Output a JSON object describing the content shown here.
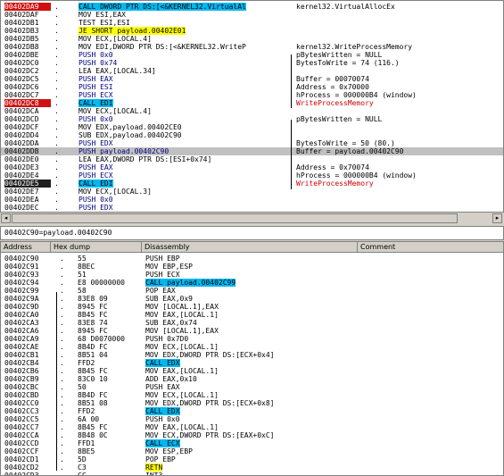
{
  "colors": {
    "breakpoint": "#d01010",
    "call": "#00b8f0",
    "jump": "#ffff00",
    "comment_red": "#d00000",
    "selected": "#c0c0c0"
  },
  "cpu": {
    "rows": [
      {
        "addr": "00402DA9",
        "instr": "CALL DWORD PTR DS:[<&KERNEL32.VirtualAl",
        "comment": "kernel32.VirtualAllocEx",
        "style": "bp",
        "ihl": "call"
      },
      {
        "addr": "00402DAF",
        "instr": "MOV ESI,EAX",
        "comment": ""
      },
      {
        "addr": "00402DB1",
        "instr": "TEST ESI,ESI",
        "comment": ""
      },
      {
        "addr": "00402DB3",
        "instr": "JE SHORT payload.00402E01",
        "comment": "",
        "ihl": "jmp"
      },
      {
        "addr": "00402DB5",
        "instr": "MOV ECX,[LOCAL.4]",
        "comment": ""
      },
      {
        "addr": "00402DB8",
        "instr": "MOV EDI,DWORD PTR DS:[<&KERNEL32.WriteP",
        "comment": "kernel32.WriteProcessMemory"
      },
      {
        "addr": "00402DBE",
        "instr": "PUSH 0x0",
        "comment": "pBytesWritten = NULL",
        "push": true
      },
      {
        "addr": "00402DC0",
        "instr": "PUSH 0x74",
        "comment": "BytesToWrite = 74 (116.)",
        "push": true
      },
      {
        "addr": "00402DC2",
        "instr": "LEA EAX,[LOCAL.34]",
        "comment": ""
      },
      {
        "addr": "00402DC5",
        "instr": "PUSH EAX",
        "comment": "Buffer = 00070074",
        "push": true
      },
      {
        "addr": "00402DC6",
        "instr": "PUSH ESI",
        "comment": "Address = 0x70000",
        "push": true
      },
      {
        "addr": "00402DC7",
        "instr": "PUSH ECX",
        "comment": "hProcess = 000000B4 (window)",
        "push": true
      },
      {
        "addr": "00402DC8",
        "instr": "CALL EDI",
        "comment": "WriteProcessMemory",
        "style": "bp",
        "ihl": "call",
        "cred": true
      },
      {
        "addr": "00402DCA",
        "instr": "MOV ECX,[LOCAL.4]",
        "comment": ""
      },
      {
        "addr": "00402DCD",
        "instr": "PUSH 0x0",
        "comment": "pBytesWritten = NULL",
        "push": true
      },
      {
        "addr": "00402DCF",
        "instr": "MOV EDX,payload.00402CE0",
        "comment": ""
      },
      {
        "addr": "00402DD4",
        "instr": "SUB EDX,payload.00402C90",
        "comment": ""
      },
      {
        "addr": "00402DDA",
        "instr": "PUSH EDX",
        "comment": "BytesToWrite = 50 (80.)",
        "push": true
      },
      {
        "addr": "00402DDB",
        "instr": "PUSH payload.00402C90",
        "comment": "Buffer = payload.00402C90",
        "push": true,
        "style": "sel"
      },
      {
        "addr": "00402DE0",
        "instr": "LEA EAX,DWORD PTR DS:[ESI+0x74]",
        "comment": ""
      },
      {
        "addr": "00402DE3",
        "instr": "PUSH EAX",
        "comment": "Address = 0x70074",
        "push": true
      },
      {
        "addr": "00402DE4",
        "instr": "PUSH ECX",
        "comment": "hProcess = 000000B4 (window)",
        "push": true
      },
      {
        "addr": "00402DE5",
        "instr": "CALL EDI",
        "comment": "WriteProcessMemory",
        "style": "blk",
        "ihl": "call",
        "cred": true
      },
      {
        "addr": "00402DE7",
        "instr": "MOV ECX,[LOCAL.3]",
        "comment": ""
      },
      {
        "addr": "00402DEA",
        "instr": "PUSH 0x0",
        "comment": "",
        "push": true
      },
      {
        "addr": "00402DEC",
        "instr": "PUSH EDX",
        "comment": "",
        "push": true
      }
    ]
  },
  "info_text": "00402C90=payload.00402C90",
  "dump": {
    "headers": {
      "address": "Address",
      "hex": "Hex dump",
      "disasm": "Disassembly",
      "comment": "Comment"
    },
    "rows": [
      {
        "addr": "00402C90",
        "hex": "55",
        "dis": "PUSH EBP"
      },
      {
        "addr": "00402C91",
        "hex": "8BEC",
        "dis": "MOV EBP,ESP"
      },
      {
        "addr": "00402C93",
        "hex": "51",
        "dis": "PUSH ECX"
      },
      {
        "addr": "00402C94",
        "hex": "E8 00000000",
        "dis": "CALL payload.00402C99",
        "ihl": "call"
      },
      {
        "addr": "00402C99",
        "hex": "58",
        "dis": "POP EAX"
      },
      {
        "addr": "00402C9A",
        "hex": "83E8 09",
        "dis": "SUB EAX,0x9"
      },
      {
        "addr": "00402C9D",
        "hex": "8945 FC",
        "dis": "MOV [LOCAL.1],EAX"
      },
      {
        "addr": "00402CA0",
        "hex": "8B45 FC",
        "dis": "MOV EAX,[LOCAL.1]"
      },
      {
        "addr": "00402CA3",
        "hex": "83E8 74",
        "dis": "SUB EAX,0x74"
      },
      {
        "addr": "00402CA6",
        "hex": "8945 FC",
        "dis": "MOV [LOCAL.1],EAX"
      },
      {
        "addr": "00402CA9",
        "hex": "68 D0070000",
        "dis": "PUSH 0x7D0"
      },
      {
        "addr": "00402CAE",
        "hex": "8B4D FC",
        "dis": "MOV ECX,[LOCAL.1]"
      },
      {
        "addr": "00402CB1",
        "hex": "8B51 04",
        "dis": "MOV EDX,DWORD PTR DS:[ECX+0x4]"
      },
      {
        "addr": "00402CB4",
        "hex": "FFD2",
        "dis": "CALL EDX",
        "ihl": "call"
      },
      {
        "addr": "00402CB6",
        "hex": "8B45 FC",
        "dis": "MOV EAX,[LOCAL.1]"
      },
      {
        "addr": "00402CB9",
        "hex": "83C0 10",
        "dis": "ADD EAX,0x10"
      },
      {
        "addr": "00402CBC",
        "hex": "50",
        "dis": "PUSH EAX"
      },
      {
        "addr": "00402CBD",
        "hex": "8B4D FC",
        "dis": "MOV ECX,[LOCAL.1]"
      },
      {
        "addr": "00402CC0",
        "hex": "8B51 08",
        "dis": "MOV EDX,DWORD PTR DS:[ECX+0x8]"
      },
      {
        "addr": "00402CC3",
        "hex": "FFD2",
        "dis": "CALL EDX",
        "ihl": "call"
      },
      {
        "addr": "00402CC5",
        "hex": "6A 00",
        "dis": "PUSH 0x0"
      },
      {
        "addr": "00402CC7",
        "hex": "8B45 FC",
        "dis": "MOV EAX,[LOCAL.1]"
      },
      {
        "addr": "00402CCA",
        "hex": "8B48 0C",
        "dis": "MOV ECX,DWORD PTR DS:[EAX+0xC]"
      },
      {
        "addr": "00402CCD",
        "hex": "FFD1",
        "dis": "CALL ECX",
        "ihl": "call"
      },
      {
        "addr": "00402CCF",
        "hex": "8BE5",
        "dis": "MOV ESP,EBP"
      },
      {
        "addr": "00402CD1",
        "hex": "5D",
        "dis": "POP EBP"
      },
      {
        "addr": "00402CD2",
        "hex": "C3",
        "dis": "RETN",
        "ihl": "jmp"
      },
      {
        "addr": "00402CD3",
        "hex": "CC",
        "dis": "INT3"
      }
    ]
  }
}
